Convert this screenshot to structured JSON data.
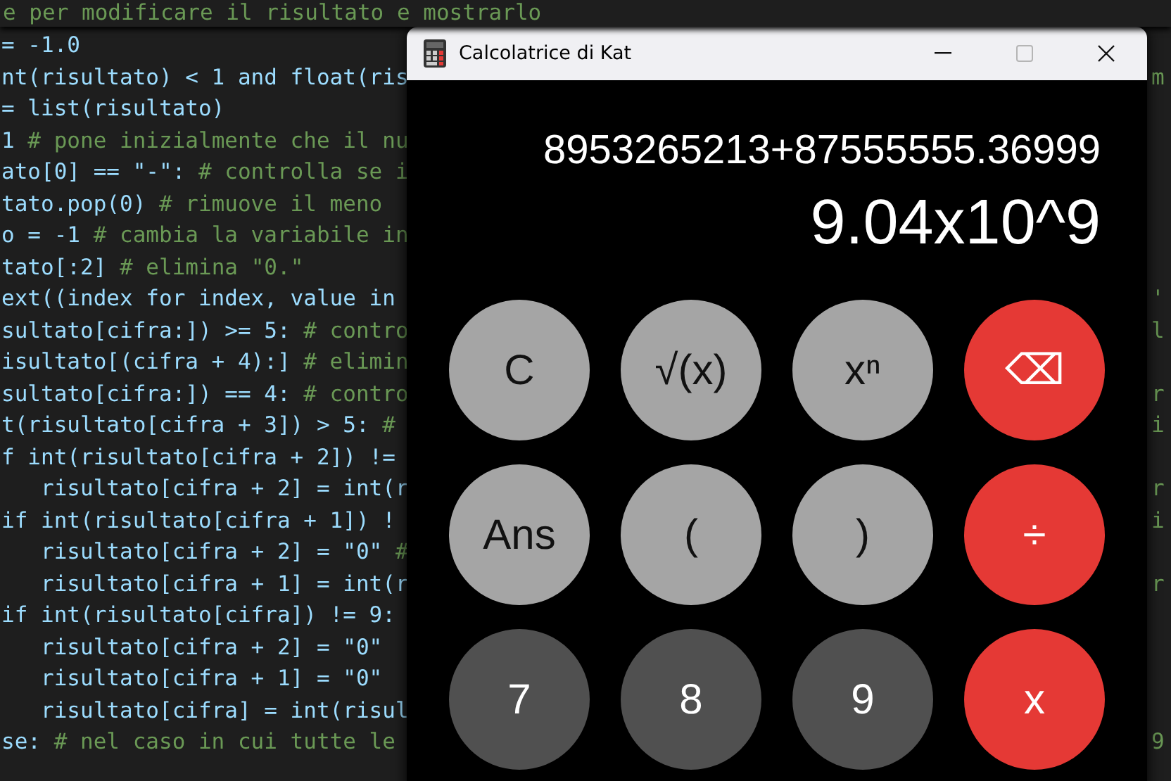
{
  "editor": {
    "sticky_header": "e per modificare il risultato e mostrarlo",
    "lines": [
      {
        "code": "= -1.0"
      },
      {
        "code": "nt(risultato) < 1 and float(ris",
        "tail": "m"
      },
      {
        "code": "= list(risultato)"
      },
      {
        "code": "1 # pone inizialmente che il nu"
      },
      {
        "code": "ato[0] == \"-\": # controlla se i"
      },
      {
        "code": "tato.pop(0) # rimuove il meno"
      },
      {
        "code": "o = -1 # cambia la variabile in"
      },
      {
        "code": "tato[:2] # elimina \"0.\""
      },
      {
        "code": "ext((index for index, value in",
        "tail": "'"
      },
      {
        "code": "sultato[cifra:]) >= 5: # contro",
        "tail": "l"
      },
      {
        "code": "isultato[(cifra + 4):] # elimin"
      },
      {
        "code": "sultato[cifra:]) == 4: # contro",
        "tail": "r"
      },
      {
        "code": "t(risultato[cifra + 3]) > 5: #",
        "tail": "i"
      },
      {
        "code": "f int(risultato[cifra + 2]) !="
      },
      {
        "code": "   risultato[cifra + 2] = int(r",
        "tail": "r"
      },
      {
        "code": "if int(risultato[cifra + 1]) !",
        "tail": "i"
      },
      {
        "code": "   risultato[cifra + 2] = \"0\" #"
      },
      {
        "code": "   risultato[cifra + 1] = int(r",
        "tail": "r"
      },
      {
        "code": "if int(risultato[cifra]) != 9:"
      },
      {
        "code": "   risultato[cifra + 2] = \"0\""
      },
      {
        "code": "   risultato[cifra + 1] = \"0\""
      },
      {
        "code": "   risultato[cifra] = int(risul"
      },
      {
        "code": "se: # nel caso in cui tutte le",
        "tail": "9"
      }
    ]
  },
  "calculator": {
    "title": "Calcolatrice di Kat",
    "expression": "8953265213+87555555.36999",
    "result": "9.04x10^9",
    "buttons": [
      {
        "label": "C",
        "kind": "function"
      },
      {
        "label": "√(x)",
        "kind": "function"
      },
      {
        "label": "xⁿ",
        "kind": "function"
      },
      {
        "label": "⌫",
        "kind": "operator"
      },
      {
        "label": "Ans",
        "kind": "function"
      },
      {
        "label": "(",
        "kind": "function"
      },
      {
        "label": ")",
        "kind": "function"
      },
      {
        "label": "÷",
        "kind": "operator"
      },
      {
        "label": "7",
        "kind": "digit"
      },
      {
        "label": "8",
        "kind": "digit"
      },
      {
        "label": "9",
        "kind": "digit"
      },
      {
        "label": "x",
        "kind": "operator"
      }
    ]
  }
}
